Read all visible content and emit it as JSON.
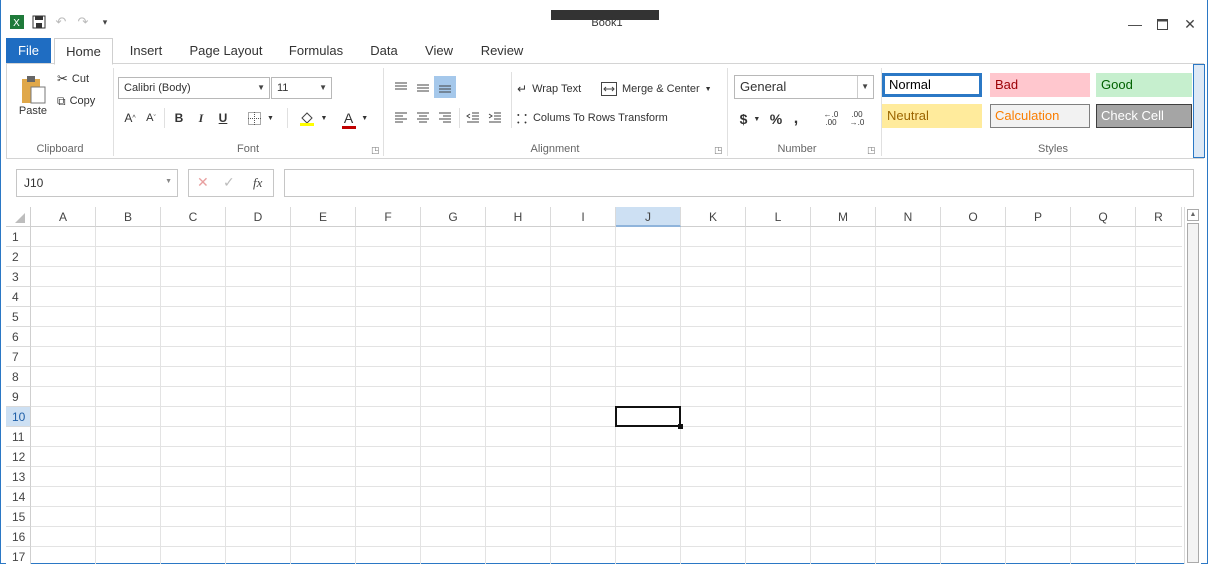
{
  "window": {
    "title": "Book1"
  },
  "tabs": [
    "File",
    "Home",
    "Insert",
    "Page Layout",
    "Formulas",
    "Data",
    "View",
    "Review"
  ],
  "clipboard": {
    "paste": "Paste",
    "cut": "Cut",
    "copy": "Copy",
    "label": "Clipboard"
  },
  "font": {
    "name": "Calibri (Body)",
    "size": "11",
    "bold": "B",
    "italic": "I",
    "underline": "U",
    "label": "Font"
  },
  "alignment": {
    "wrap_text": "Wrap Text",
    "merge_center": "Merge & Center",
    "columns_to_rows": "Colums To Rows Transform",
    "label": "Alignment"
  },
  "number": {
    "format": "General",
    "currency": "$",
    "percent": "%",
    "comma": ",",
    "inc_decimal": "←.0 .00",
    "dec_decimal": ".00 →.0",
    "label": "Number"
  },
  "styles": {
    "label": "Styles",
    "cells": [
      {
        "name": "Normal",
        "bg": "#ffffff",
        "fg": "#000000",
        "border": "#2b78c5"
      },
      {
        "name": "Bad",
        "bg": "#ffc7ce",
        "fg": "#9c0006",
        "border": "#ffc7ce"
      },
      {
        "name": "Good",
        "bg": "#c6efce",
        "fg": "#006100",
        "border": "#c6efce"
      },
      {
        "name": "Neutral",
        "bg": "#ffeb9c",
        "fg": "#9c6500",
        "border": "#ffeb9c"
      },
      {
        "name": "Calculation",
        "bg": "#f2f2f2",
        "fg": "#fa7d00",
        "border": "#7f7f7f"
      },
      {
        "name": "Check Cell",
        "bg": "#a5a5a5",
        "fg": "#ffffff",
        "border": "#3f3f3f"
      }
    ]
  },
  "formula_bar": {
    "name_box": "J10",
    "fx": "fx",
    "value": ""
  },
  "sheet": {
    "columns": [
      "A",
      "B",
      "C",
      "D",
      "E",
      "F",
      "G",
      "H",
      "I",
      "J",
      "K",
      "L",
      "M",
      "N",
      "O",
      "P",
      "Q",
      "R"
    ],
    "rows": [
      "1",
      "2",
      "3",
      "4",
      "5",
      "6",
      "7",
      "8",
      "9",
      "10",
      "11",
      "12",
      "13",
      "14",
      "15",
      "16",
      "17"
    ],
    "selected_cell": "J10",
    "selected_col": "J",
    "selected_row": "10"
  },
  "colors": {
    "accent": "#1f6dc2",
    "selection_header": "#cde0f3"
  }
}
